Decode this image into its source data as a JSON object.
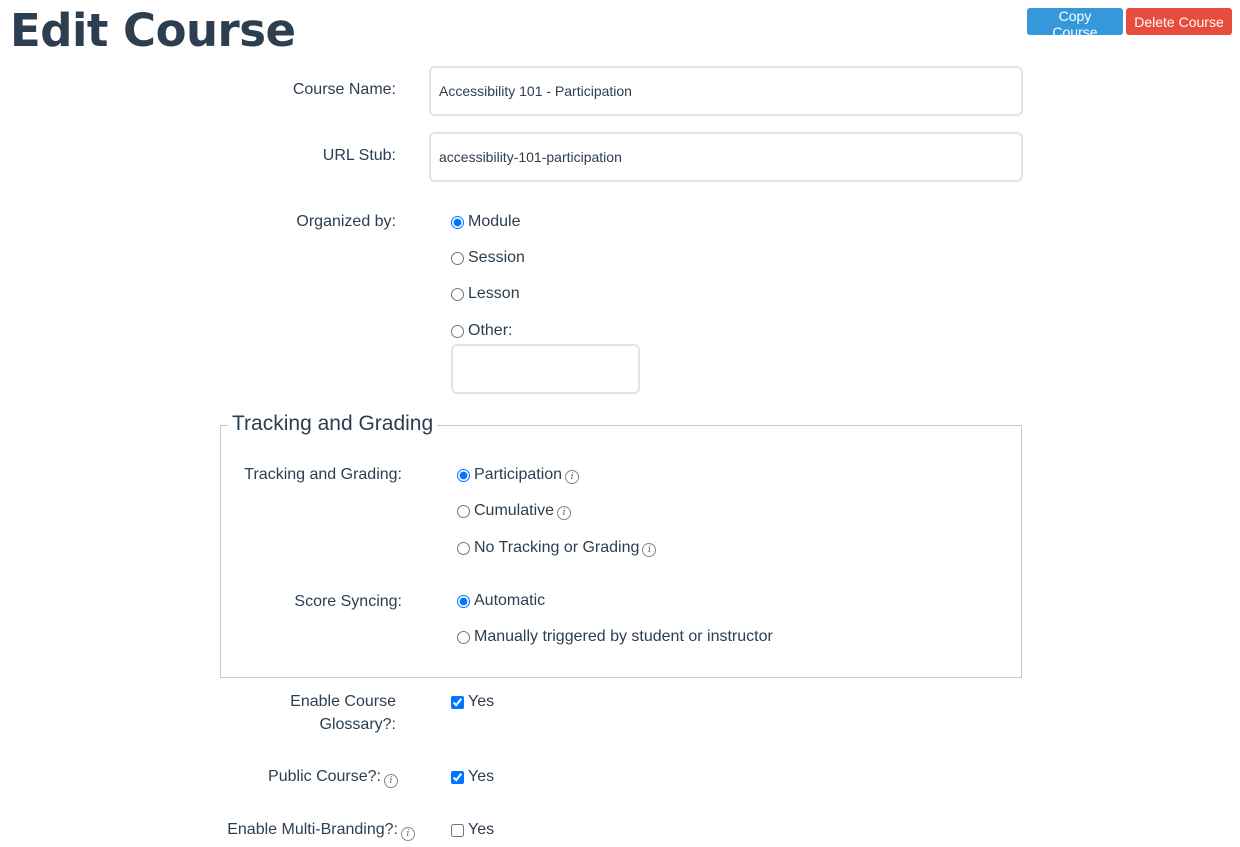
{
  "header": {
    "title": "Edit Course",
    "copy_label": "Copy Course",
    "delete_label": "Delete Course"
  },
  "form": {
    "course_name": {
      "label": "Course Name:",
      "value": "Accessibility 101 - Participation"
    },
    "url_stub": {
      "label": "URL Stub:",
      "value": "accessibility-101-participation"
    },
    "organized_by": {
      "label": "Organized by:",
      "options": [
        "Module",
        "Session",
        "Lesson",
        "Other:"
      ],
      "selected": "Module",
      "other_value": ""
    },
    "tracking": {
      "legend": "Tracking and Grading",
      "label": "Tracking and Grading:",
      "options": [
        "Participation",
        "Cumulative",
        "No Tracking or Grading"
      ],
      "selected": "Participation"
    },
    "score_syncing": {
      "label": "Score Syncing:",
      "options": [
        "Automatic",
        "Manually triggered by student or instructor"
      ],
      "selected": "Automatic"
    },
    "glossary": {
      "label_line1": "Enable Course",
      "label_line2": "Glossary?:",
      "option": "Yes",
      "checked": true
    },
    "public_course": {
      "label": "Public Course?:",
      "option": "Yes",
      "checked": true
    },
    "multi_branding": {
      "label": "Enable Multi-Branding?:",
      "option": "Yes",
      "checked": false
    }
  },
  "icons": {
    "info": "info-icon"
  },
  "colors": {
    "primary": "#3498db",
    "danger": "#e74c3c",
    "text": "#2d3e50"
  }
}
